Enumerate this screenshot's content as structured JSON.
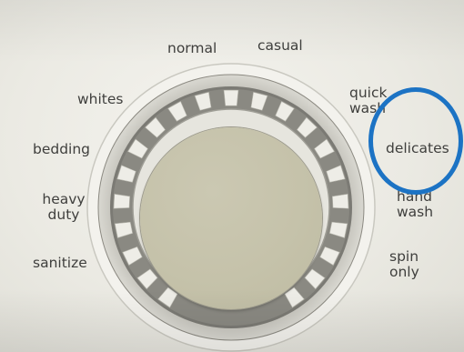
{
  "dial": {
    "cycles": [
      {
        "id": "normal",
        "label": "normal"
      },
      {
        "id": "casual",
        "label": "casual"
      },
      {
        "id": "whites",
        "label": "whites"
      },
      {
        "id": "quick-wash",
        "label": "quick\nwash"
      },
      {
        "id": "bedding",
        "label": "bedding"
      },
      {
        "id": "delicates",
        "label": "delicates"
      },
      {
        "id": "heavy-duty",
        "label": "heavy\nduty"
      },
      {
        "id": "hand-wash",
        "label": "hand\nwash"
      },
      {
        "id": "sanitize",
        "label": "sanitize"
      },
      {
        "id": "spin-only",
        "label": "spin\nonly"
      }
    ],
    "highlighted_cycle": "delicates",
    "colors": {
      "panel": "#ecebe4",
      "label_text": "#3f3f3d",
      "knob": "#c5c2aa",
      "highlight_ring": "#1c73c4"
    }
  }
}
